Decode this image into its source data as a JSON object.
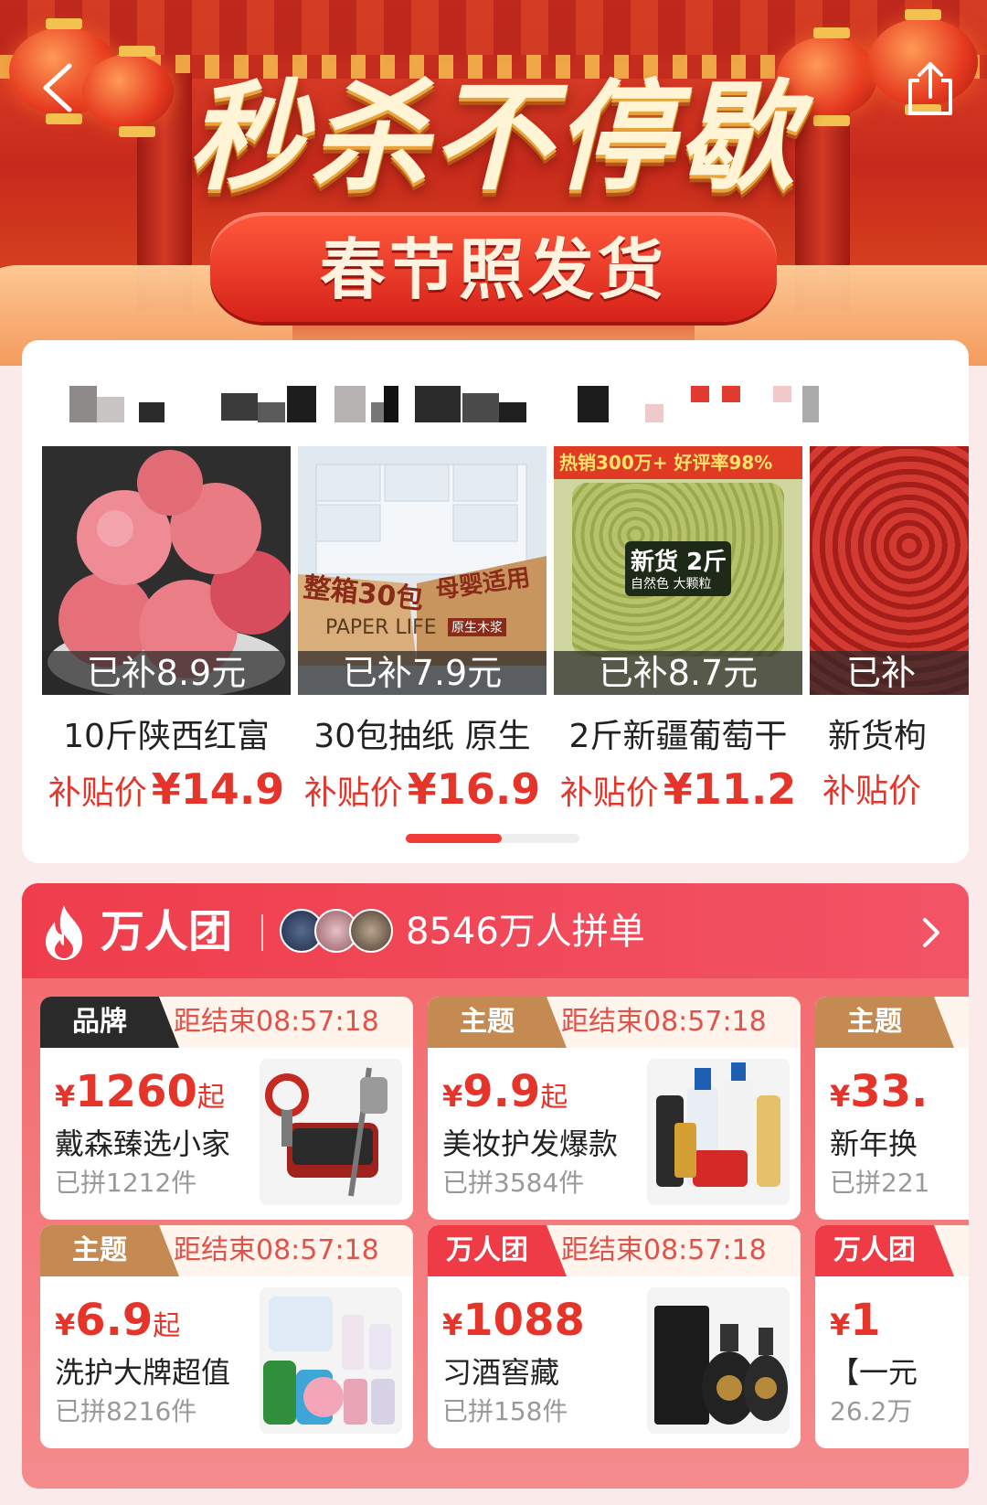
{
  "banner": {
    "title": "秒杀不停歇",
    "subtitle": "春节照发货"
  },
  "subsidy": {
    "products": [
      {
        "tag": "已补8.9元",
        "name": "10斤陕西红富",
        "price_label": "补贴价",
        "price": "¥14.9",
        "image": "apples"
      },
      {
        "tag": "已补7.9元",
        "name": "30包抽纸 原生",
        "price_label": "补贴价",
        "price": "¥16.9",
        "image": "tissue-box",
        "image_text": [
          "整箱30包",
          "母婴适用",
          "PAPER LIFE",
          "原生木浆"
        ]
      },
      {
        "tag": "已补8.7元",
        "name": "2斤新疆葡萄干",
        "price_label": "补贴价",
        "price": "¥11.2",
        "image": "raisins",
        "image_text": [
          "热销300万+ 好评率98%",
          "新货 2斤",
          "自然色 大颗粒"
        ]
      },
      {
        "tag": "已补",
        "name": "新货枸",
        "price_label": "补贴价",
        "price": "",
        "image": "goji"
      }
    ],
    "scroll_progress": 0.55
  },
  "group": {
    "title": "万人团",
    "count_text": "8546万人拼单",
    "deals": [
      {
        "badge": "品牌",
        "badge_style": "black",
        "timer": "距结束08:57:18",
        "yen": "¥",
        "price": "1260",
        "qi": "起",
        "name": "戴森臻选小家",
        "sold": "已拼1212件",
        "image": "dyson"
      },
      {
        "badge": "主题",
        "badge_style": "gold",
        "timer": "距结束08:57:18",
        "yen": "¥",
        "price": "9.9",
        "qi": "起",
        "name": "美妆护发爆款",
        "sold": "已拼3584件",
        "image": "haircare"
      },
      {
        "badge": "主题",
        "badge_style": "gold",
        "timer": "",
        "yen": "¥",
        "price": "33.",
        "qi": "",
        "name": "新年换",
        "sold": "已拼221",
        "image": ""
      },
      {
        "badge": "主题",
        "badge_style": "gold",
        "timer": "距结束08:57:18",
        "yen": "¥",
        "price": "6.9",
        "qi": "起",
        "name": "洗护大牌超值",
        "sold": "已拼8216件",
        "image": "laundry"
      },
      {
        "badge": "万人团",
        "badge_style": "red",
        "timer": "距结束08:57:18",
        "yen": "¥",
        "price": "1088",
        "qi": "",
        "name": "习酒窖藏",
        "sold": "已拼158件",
        "image": "liquor"
      },
      {
        "badge": "万人团",
        "badge_style": "red",
        "timer": "",
        "yen": "¥",
        "price": "1",
        "qi": "",
        "name": "【一元",
        "sold": "26.2万",
        "image": ""
      }
    ]
  },
  "colors": {
    "accent": "#e5352b",
    "banner_red": "#c72a1c",
    "group_red": "#ef3d4c",
    "badge_gold": "#c48a52"
  }
}
